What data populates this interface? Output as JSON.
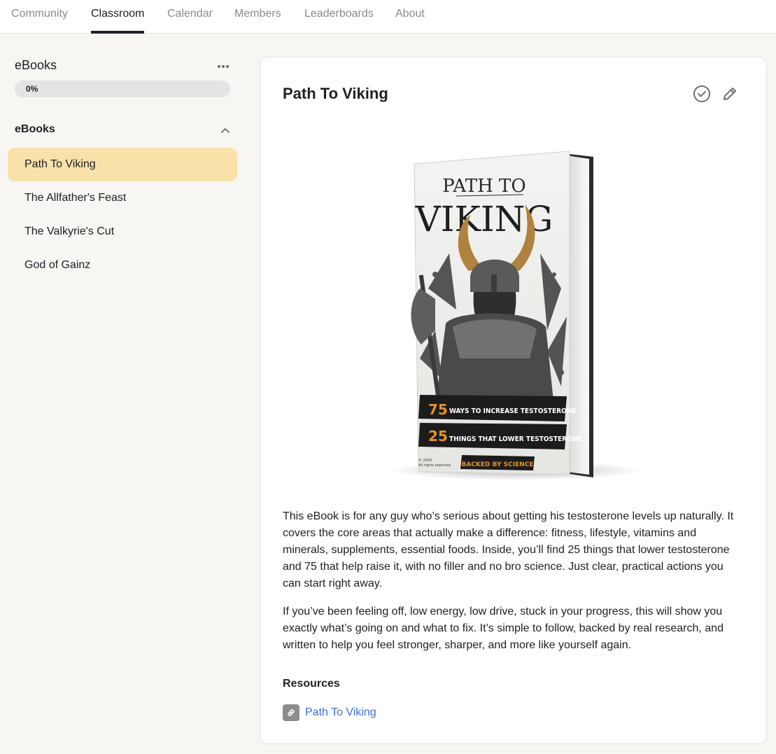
{
  "nav": {
    "tabs": [
      {
        "label": "Community"
      },
      {
        "label": "Classroom"
      },
      {
        "label": "Calendar"
      },
      {
        "label": "Members"
      },
      {
        "label": "Leaderboards"
      },
      {
        "label": "About"
      }
    ],
    "active_tab": "Classroom"
  },
  "sidebar": {
    "course_title": "eBooks",
    "progress_percent": 0,
    "progress_label": "0%",
    "section_title": "eBooks",
    "section_expanded": true,
    "lessons": [
      {
        "label": "Path To Viking",
        "active": true
      },
      {
        "label": "The Allfather's Feast",
        "active": false
      },
      {
        "label": "The Valkyrie's Cut",
        "active": false
      },
      {
        "label": "God of Gainz",
        "active": false
      }
    ]
  },
  "main": {
    "title": "Path To Viking",
    "cover": {
      "title_line1": "PATH TO",
      "title_line2": "VIKING",
      "banner1_number": "75",
      "banner1_text": "WAYS TO INCREASE TESTOSTERONE",
      "banner2_number": "25",
      "banner2_text": "THINGS THAT LOWER TESTOSTERONE",
      "banner3_text": "BACKED BY SCIENCE",
      "copyright_line1": "© 2025.",
      "copyright_line2": "All rights reserved."
    },
    "paragraphs": [
      "This eBook is for any guy who’s serious about getting his testosterone levels up naturally. It covers the core areas that actually make a difference: fitness, lifestyle, vitamins and minerals, supplements, essential foods. Inside, you’ll find 25 things that lower testosterone and 75 that help raise it, with no filler and no bro science. Just clear, practical actions you can start right away.",
      "If you’ve been feeling off, low energy, low drive, stuck in your progress, this will show you exactly what’s going on and what to fix. It’s simple to follow, backed by real research, and written to help you feel stronger, sharper, and more like yourself again."
    ],
    "resources_title": "Resources",
    "resources": [
      {
        "label": "Path To Viking",
        "icon": "link-icon"
      }
    ]
  },
  "colors": {
    "active_lesson_bg": "#f9e2aa",
    "link": "#3b6fd8",
    "accent_orange": "#e3922b"
  },
  "icons": {
    "more": "more-horizontal-icon",
    "collapse": "chevron-up-icon",
    "complete": "check-circle-icon",
    "edit": "pencil-icon",
    "resource": "link-icon"
  }
}
